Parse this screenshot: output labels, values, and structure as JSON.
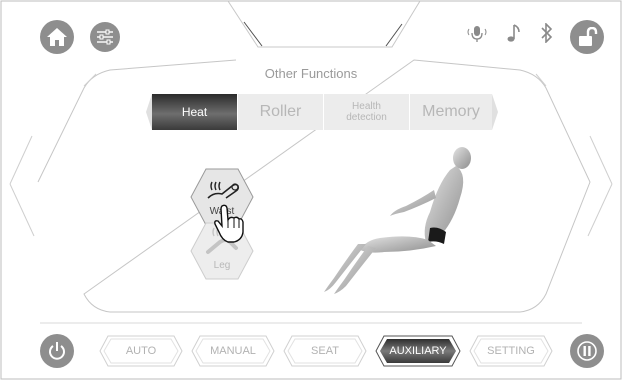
{
  "header": {
    "home_icon": "home-icon",
    "settings_icon": "sliders-icon",
    "voice_icon": "microphone-icon",
    "music_icon": "music-note-icon",
    "bluetooth_icon": "bluetooth-icon",
    "lock_icon": "unlocked-padlock-icon"
  },
  "panel": {
    "title": "Other Functions",
    "tabs": [
      {
        "label": "Heat",
        "active": true
      },
      {
        "label": "Roller",
        "active": false
      },
      {
        "label": "Health detection",
        "active": false
      },
      {
        "label": "Memory",
        "active": false
      }
    ]
  },
  "heat_zones": [
    {
      "label": "Waist",
      "icon": "waist-heat-icon",
      "state": "selected"
    },
    {
      "label": "Leg",
      "icon": "leg-heat-icon",
      "state": "disabled"
    }
  ],
  "figure": {
    "name": "reclining-body-model",
    "heated_area": "waist"
  },
  "footer": {
    "power_icon": "power-icon",
    "pause_icon": "pause-icon",
    "modes": [
      {
        "label": "AUTO",
        "active": false
      },
      {
        "label": "MANUAL",
        "active": false
      },
      {
        "label": "SEAT",
        "active": false
      },
      {
        "label": "AUXILIARY",
        "active": true
      },
      {
        "label": "SETTING",
        "active": false
      }
    ]
  },
  "colors": {
    "icon_gray": "#8e8e8e",
    "line_gray": "#c8c8c8",
    "tab_bg": "#ececec",
    "active_dark": "#2b2b2b",
    "heat_band": "#1a1a1a"
  }
}
